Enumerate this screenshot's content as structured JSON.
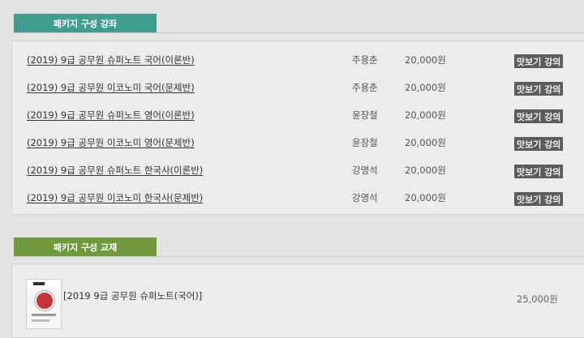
{
  "lectures_section": {
    "tab_label": "패키지 구성 강좌",
    "rows": [
      {
        "title": "(2019) 9급 공무원 슈퍼노트 국어(이론반)",
        "teacher": "주용춘",
        "price": "20,000원",
        "preview_label": "맛보기 강의"
      },
      {
        "title": "(2019) 9급 공무원 이코노미 국어(문제반)",
        "teacher": "주용춘",
        "price": "20,000원",
        "preview_label": "맛보기 강의"
      },
      {
        "title": "(2019) 9급 공무원 슈퍼노트 영어(이론반)",
        "teacher": "윤장철",
        "price": "20,000원",
        "preview_label": "맛보기 강의"
      },
      {
        "title": "(2019) 9급 공무원 이코노미 영어(문제반)",
        "teacher": "윤장철",
        "price": "20,000원",
        "preview_label": "맛보기 강의"
      },
      {
        "title": "(2019) 9급 공무원 슈퍼노트 한국사(이론반)",
        "teacher": "강명석",
        "price": "20,000원",
        "preview_label": "맛보기 강의"
      },
      {
        "title": "(2019) 9급 공무원 이코노미 한국사(문제반)",
        "teacher": "강명석",
        "price": "20,000원",
        "preview_label": "맛보기 강의"
      }
    ]
  },
  "books_section": {
    "tab_label": "패키지 구성 교재",
    "items": [
      {
        "title": "[2019 9급 공무원 슈퍼노트(국어)]",
        "price": "25,000원",
        "thumbnail_icon": "book-cover-icon"
      }
    ]
  },
  "colors": {
    "lectures_tab": "#3f9e8e",
    "books_tab": "#6e9a3c",
    "preview_button": "#5c5c5c",
    "background": "#e4e4e2"
  }
}
